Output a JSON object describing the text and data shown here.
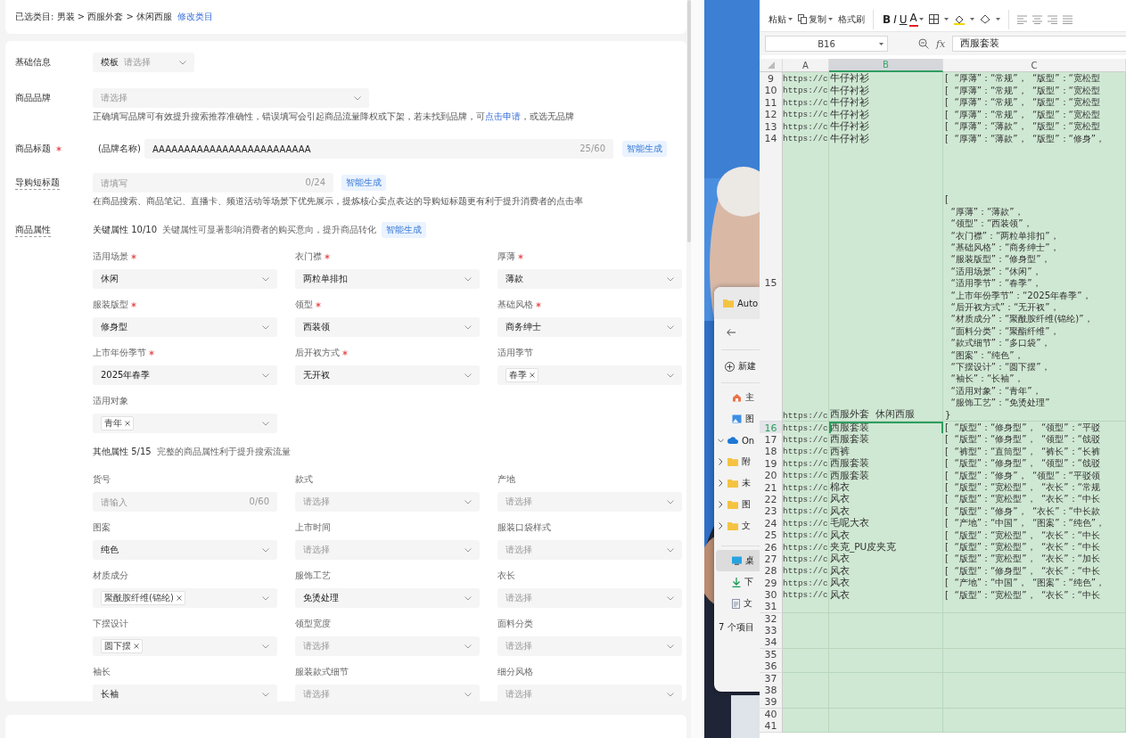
{
  "breadcrumb": {
    "text": "已选类目: 男装 > 西服外套 > 休闲西服",
    "link": "修改类目"
  },
  "basic": {
    "label": "基础信息",
    "template_label": "模板",
    "template_placeholder": "请选择"
  },
  "brand": {
    "label": "商品品牌",
    "placeholder": "请选择",
    "hint_before": "正确填写品牌可有效提升搜索推荐准确性，错误填写会引起商品流量降权或下架，若未找到品牌，可",
    "hint_link": "点击申请",
    "hint_after": "，或选无品牌"
  },
  "title": {
    "label": "商品标题",
    "required": true,
    "prefix": "(品牌名称)",
    "value": "AAAAAAAAAAAAAAAAAAAAAAAAA",
    "counter": "25/60",
    "ai_button": "智能生成"
  },
  "short_title": {
    "label": "导购短标题",
    "placeholder": "请填写",
    "counter": "0/24",
    "ai_button": "智能生成",
    "hint": "在商品搜索、商品笔记、直播卡、频道活动等场景下优先展示，提炼核心卖点表达的导购短标题更有利于提升消费者的点击率"
  },
  "attributes": {
    "label": "商品属性",
    "key_group": {
      "title": "关键属性 10/10",
      "hint": "关键属性可显著影响消费者的购买意向，提升商品转化",
      "ai_button": "智能生成",
      "fields": [
        {
          "label": "适用场景",
          "required": true,
          "kind": "select",
          "value": "休闲"
        },
        {
          "label": "衣门襟",
          "required": true,
          "kind": "select",
          "value": "两粒单排扣"
        },
        {
          "label": "厚薄",
          "required": true,
          "kind": "select",
          "value": "薄款"
        },
        {
          "label": "服装版型",
          "required": true,
          "kind": "select",
          "value": "修身型"
        },
        {
          "label": "领型",
          "required": true,
          "kind": "select",
          "value": "西装领"
        },
        {
          "label": "基础风格",
          "required": true,
          "kind": "select",
          "value": "商务绅士"
        },
        {
          "label": "上市年份季节",
          "required": true,
          "kind": "select",
          "value": "2025年春季"
        },
        {
          "label": "后开衩方式",
          "required": true,
          "kind": "select",
          "value": "无开衩"
        },
        {
          "label": "适用季节",
          "required": false,
          "kind": "multi",
          "tags": [
            "春季"
          ]
        },
        {
          "label": "适用对象",
          "required": false,
          "kind": "multi",
          "tags": [
            "青年"
          ]
        }
      ]
    },
    "other_group": {
      "title": "其他属性 5/15",
      "hint": "完整的商品属性利于提升搜索流量",
      "fields": [
        {
          "label": "货号",
          "required": false,
          "kind": "text",
          "placeholder": "请输入",
          "counter": "0/60"
        },
        {
          "label": "款式",
          "required": false,
          "kind": "select",
          "placeholder": "请选择"
        },
        {
          "label": "产地",
          "required": false,
          "kind": "select",
          "placeholder": "请选择"
        },
        {
          "label": "图案",
          "required": false,
          "kind": "select",
          "value": "纯色"
        },
        {
          "label": "上市时间",
          "required": false,
          "kind": "select",
          "placeholder": "请选择"
        },
        {
          "label": "服装口袋样式",
          "required": false,
          "kind": "select",
          "placeholder": "请选择"
        },
        {
          "label": "材质成分",
          "required": false,
          "kind": "multi",
          "tags": [
            "聚酰胺纤维(锦纶)"
          ]
        },
        {
          "label": "服饰工艺",
          "required": false,
          "kind": "select",
          "value": "免烫处理"
        },
        {
          "label": "衣长",
          "required": false,
          "kind": "select",
          "placeholder": "请选择"
        },
        {
          "label": "下摆设计",
          "required": false,
          "kind": "multi",
          "tags": [
            "圆下摆"
          ]
        },
        {
          "label": "领型宽度",
          "required": false,
          "kind": "select",
          "placeholder": "请选择"
        },
        {
          "label": "面料分类",
          "required": false,
          "kind": "select",
          "placeholder": "请选择"
        },
        {
          "label": "袖长",
          "required": false,
          "kind": "select",
          "value": "长袖"
        },
        {
          "label": "服装款式细节",
          "required": false,
          "kind": "select",
          "placeholder": "请选择"
        },
        {
          "label": "细分风格",
          "required": false,
          "kind": "select",
          "placeholder": "请选择"
        }
      ]
    }
  },
  "explorer": {
    "title": "Auto",
    "new_button": "新建",
    "quick": [
      {
        "label": "主",
        "kind": "home"
      },
      {
        "label": "图",
        "kind": "pictures"
      }
    ],
    "tree": [
      {
        "label": "On",
        "kind": "cloud",
        "expanded": true
      },
      {
        "label": "附",
        "kind": "folder",
        "expanded": false
      },
      {
        "label": "未",
        "kind": "folder",
        "expanded": false
      },
      {
        "label": "图",
        "kind": "folder",
        "expanded": false
      },
      {
        "label": "文",
        "kind": "folder",
        "expanded": false
      }
    ],
    "places": [
      {
        "label": "桌",
        "kind": "desktop",
        "selected": true
      },
      {
        "label": "下",
        "kind": "download",
        "selected": false
      },
      {
        "label": "文",
        "kind": "document",
        "selected": false
      }
    ],
    "status": "7 个项目"
  },
  "spreadsheet": {
    "clipboard": [
      {
        "label": "粘贴",
        "kind": "paste"
      },
      {
        "label": "复制",
        "kind": "copy"
      },
      {
        "label": "格式刷",
        "kind": "brush"
      }
    ],
    "format": [
      {
        "label": "B",
        "kind": "bold"
      },
      {
        "label": "I",
        "kind": "italic"
      },
      {
        "label": "U",
        "kind": "underline"
      },
      {
        "label": "A",
        "kind": "font_color"
      }
    ],
    "name_box": "B16",
    "function_label": "fx",
    "formula": "西服套装",
    "columns": [
      {
        "label": "A",
        "selected": false
      },
      {
        "label": "B",
        "selected": true
      },
      {
        "label": "C",
        "selected": false
      }
    ],
    "rows": [
      {
        "number": "9",
        "a": "https://c",
        "b": "牛仔衬衫",
        "c": "[  “厚薄”：“常规”，  “版型”：“宽松型",
        "selected": false
      },
      {
        "number": "10",
        "a": "https://c",
        "b": "牛仔衬衫",
        "c": "[  “厚薄”：“常规”，  “版型”：“宽松型",
        "selected": false
      },
      {
        "number": "11",
        "a": "https://c",
        "b": "牛仔衬衫",
        "c": "[  “厚薄”：“常规”，  “版型”：“宽松型",
        "selected": false
      },
      {
        "number": "12",
        "a": "https://c",
        "b": "牛仔衬衫",
        "c": "[  “厚薄”：“常规”，  “版型”：“宽松型",
        "selected": false
      },
      {
        "number": "13",
        "a": "https://c",
        "b": "牛仔衬衫",
        "c": "[  “厚薄”：“薄款”，  “版型”：“宽松型",
        "selected": false
      },
      {
        "number": "14",
        "a": "https://c",
        "b": "牛仔衬衫",
        "c": "[  “厚薄”：“薄款”，  “版型”：“修身”，",
        "selected": false
      },
      {
        "number": "15",
        "a": "https://c",
        "b": "西服外套  休闲西服",
        "c": "[\n  “厚薄”：“薄款”，\n  “领型”：“西装领”，\n  “衣门襟”：“两粒单排扣”，\n  “基础风格”：“商务绅士”，\n  “服装版型”：“修身型”，\n  “适用场景”：“休闲”，\n  “适用季节”：“春季”，\n  “上市年份季节”：“2025年春季”，\n  “后开衩方式”：“无开衩”，\n  “材质成分”：“聚酰胺纤维(锦纶)”，\n  “面料分类”：“聚酯纤维”，\n  “款式细节”：“多口袋”，\n  “图案”：“纯色”，\n  “下摆设计”：“圆下摆”，\n  “袖长”：“长袖”，\n  “适用对象”：“青年”，\n  “服饰工艺”：“免烫处理”\n}",
        "selected": false
      },
      {
        "number": "16",
        "a": "https://c",
        "b": "西服套装",
        "c": "[  “版型”：“修身型”，  “领型”：“平驳",
        "selected": true
      },
      {
        "number": "17",
        "a": "https://c",
        "b": "西服套装",
        "c": "[  “版型”：“修身型”，  “领型”：“戗驳",
        "selected": false
      },
      {
        "number": "18",
        "a": "https://c",
        "b": "西裤",
        "c": "[  “裤型”：“直筒型”，  “裤长”：“长裤",
        "selected": false
      },
      {
        "number": "19",
        "a": "https://c",
        "b": "西服套装",
        "c": "[  “版型”：“修身型”，  “领型”：“戗驳",
        "selected": false
      },
      {
        "number": "20",
        "a": "https://c",
        "b": "西服套装",
        "c": "[  “版型”：“修身”，  “领型”：“平驳领",
        "selected": false
      },
      {
        "number": "21",
        "a": "https://c",
        "b": "棉衣",
        "c": "[  “版型”：“宽松型”，  “衣长”：“常规",
        "selected": false
      },
      {
        "number": "22",
        "a": "https://c",
        "b": "风衣",
        "c": "[  “版型”：“宽松型”，  “衣长”：“中长",
        "selected": false
      },
      {
        "number": "23",
        "a": "https://c",
        "b": "风衣",
        "c": "[  “版型”：“修身”，  “衣长”：“中长款",
        "selected": false
      },
      {
        "number": "24",
        "a": "https://c",
        "b": "毛呢大衣",
        "c": "[  “产地”：“中国”，  “图案”：“纯色”，",
        "selected": false
      },
      {
        "number": "25",
        "a": "https://c",
        "b": "风衣",
        "c": "[  “版型”：“宽松型”，  “衣长”：“中长",
        "selected": false
      },
      {
        "number": "26",
        "a": "https://c",
        "b": "夹克_PU皮夹克",
        "c": "[  “版型”：“宽松型”，  “衣长”：“中长",
        "selected": false
      },
      {
        "number": "27",
        "a": "https://c",
        "b": "风衣",
        "c": "[  “版型”：“宽松型”，  “衣长”：“加长",
        "selected": false
      },
      {
        "number": "28",
        "a": "https://c",
        "b": "风衣",
        "c": "[  “版型”：“修身型”，  “衣长”：“中长",
        "selected": false
      },
      {
        "number": "29",
        "a": "https://c",
        "b": "风衣",
        "c": "[  “产地”：“中国”，  “图案”：“纯色”，",
        "selected": false
      },
      {
        "number": "30",
        "a": "https://c",
        "b": "风衣",
        "c": "[  “版型”：“宽松型”，  “衣长”：“中长",
        "selected": false
      },
      {
        "number": "31",
        "selected": false
      },
      {
        "number": "32",
        "selected": false
      },
      {
        "number": "33",
        "selected": false
      },
      {
        "number": "34",
        "selected": false
      },
      {
        "number": "35",
        "selected": false
      },
      {
        "number": "36",
        "selected": false
      },
      {
        "number": "37",
        "selected": false
      },
      {
        "number": "38",
        "selected": false
      },
      {
        "number": "39",
        "selected": false
      },
      {
        "number": "40",
        "selected": false
      },
      {
        "number": "41",
        "selected": false
      }
    ]
  }
}
